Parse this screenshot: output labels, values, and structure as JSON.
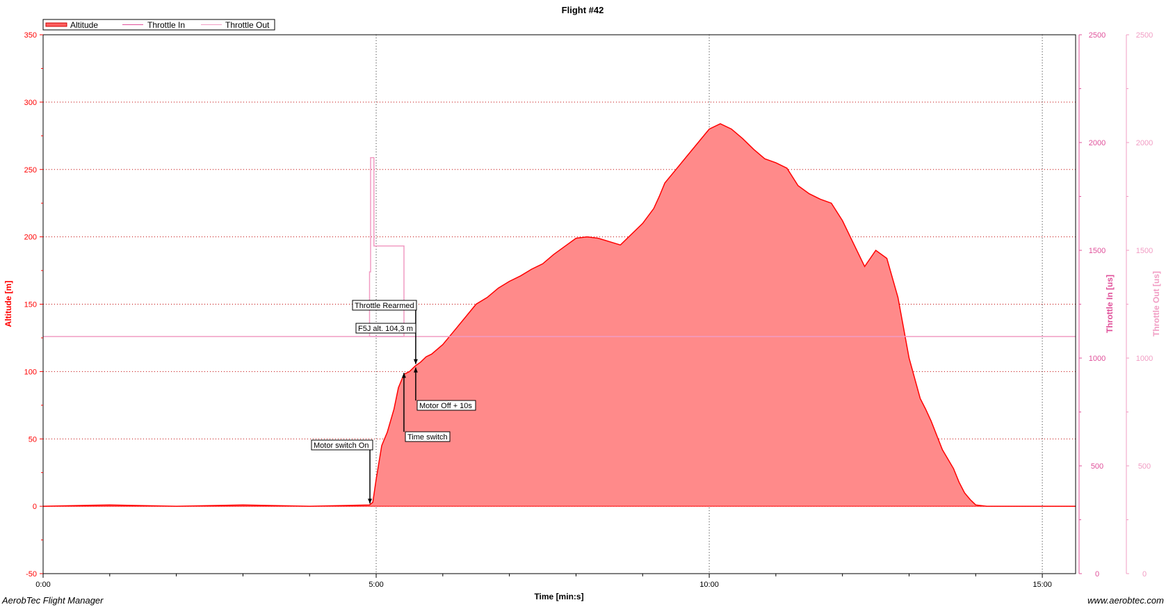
{
  "title": "Flight #42",
  "footer": {
    "left": "AerobTec Flight Manager",
    "right": "www.aerobtec.com"
  },
  "colors": {
    "altitude_line": "#ff0000",
    "altitude_fill": "#ff8a8a",
    "throttle_in": "#e0509a",
    "throttle_out": "#f19cc3",
    "grid": "#c00000",
    "grid_v": "#333333"
  },
  "chart_data": {
    "type": "area",
    "title": "Flight #42",
    "xlabel": "Time [min:s]",
    "x_ticks": [
      "0:00",
      "5:00",
      "10:00",
      "15:00"
    ],
    "xlim": [
      0,
      930
    ],
    "axes": {
      "left": {
        "label": "Altitude [m]",
        "ylim": [
          -50,
          350
        ],
        "ticks": [
          -50,
          0,
          50,
          100,
          150,
          200,
          250,
          300,
          350
        ]
      },
      "right1": {
        "label": "Throttle In [us]",
        "ylim": [
          0,
          2500
        ],
        "ticks": [
          0,
          500,
          1000,
          1500,
          2000,
          2500
        ]
      },
      "right2": {
        "label": "Throttle Out [us]",
        "ylim": [
          0,
          2500
        ],
        "ticks": [
          0,
          500,
          1000,
          1500,
          2000,
          2500
        ]
      }
    },
    "legend": {
      "position": "top-left",
      "entries": [
        "Altitude",
        "Throttle In",
        "Throttle Out"
      ]
    },
    "grid": true,
    "series": [
      {
        "name": "Altitude",
        "unit": "m",
        "axis": "left",
        "x": [
          0,
          60,
          120,
          180,
          240,
          294,
          297,
          300,
          305,
          310,
          316,
          320,
          325,
          330,
          335,
          340,
          345,
          350,
          360,
          370,
          380,
          390,
          400,
          410,
          420,
          430,
          440,
          450,
          460,
          470,
          480,
          490,
          500,
          520,
          540,
          550,
          555,
          560,
          570,
          580,
          590,
          600,
          610,
          620,
          630,
          640,
          650,
          660,
          670,
          680,
          690,
          700,
          710,
          720,
          730,
          740,
          750,
          760,
          770,
          780,
          790,
          795,
          800,
          810,
          820,
          825,
          830,
          835,
          840,
          850,
          860,
          870,
          880,
          890,
          900,
          910,
          920,
          930
        ],
        "values": [
          0,
          1,
          0,
          1,
          0,
          1,
          3,
          20,
          45,
          55,
          72,
          88,
          98,
          100,
          104,
          107,
          111,
          113,
          120,
          130,
          140,
          150,
          155,
          162,
          167,
          171,
          176,
          180,
          187,
          193,
          199,
          200,
          199,
          194,
          210,
          221,
          230,
          240,
          250,
          260,
          270,
          280,
          284,
          280,
          273,
          265,
          258,
          255,
          251,
          238,
          232,
          228,
          225,
          212,
          195,
          178,
          190,
          184,
          155,
          110,
          80,
          72,
          63,
          42,
          28,
          18,
          10,
          5,
          1,
          0,
          0,
          0,
          0,
          0,
          0,
          0,
          0,
          0
        ]
      },
      {
        "name": "Throttle In",
        "unit": "us",
        "axis": "right1",
        "x": [
          0,
          295,
          296,
          297,
          298,
          299,
          300,
          301,
          302,
          303,
          304,
          305,
          306,
          307,
          308,
          309,
          310,
          315,
          320,
          325,
          330,
          335,
          340,
          345,
          350,
          930
        ],
        "values": [
          1100,
          1100,
          1100,
          1100,
          1100,
          1100,
          1100,
          1100,
          1100,
          1100,
          1100,
          1100,
          1100,
          1100,
          1100,
          1100,
          1100,
          1100,
          1100,
          1100,
          1100,
          1100,
          1100,
          1100,
          1100,
          1100
        ]
      },
      {
        "name": "Throttle Out",
        "unit": "us",
        "axis": "right2",
        "x": [
          0,
          294,
          294,
          295,
          295,
          298,
          298,
          300,
          300,
          325,
          325,
          327,
          327,
          930
        ],
        "values": [
          1100,
          1100,
          1400,
          1400,
          1930,
          1930,
          1520,
          1520,
          1520,
          1520,
          1100,
          1100,
          1100,
          1100
        ]
      }
    ],
    "annotations": [
      {
        "text": "Motor switch On",
        "x": 295,
        "y": 2
      },
      {
        "text": "Time switch",
        "x": 325,
        "y": 99
      },
      {
        "text": "Motor Off + 10s",
        "x": 335,
        "y": 103
      },
      {
        "text": "Throttle Rearmed",
        "x": 335,
        "y": 104
      },
      {
        "text": "F5J alt. 104,3 m",
        "x": 335,
        "y": 104.3
      }
    ]
  }
}
